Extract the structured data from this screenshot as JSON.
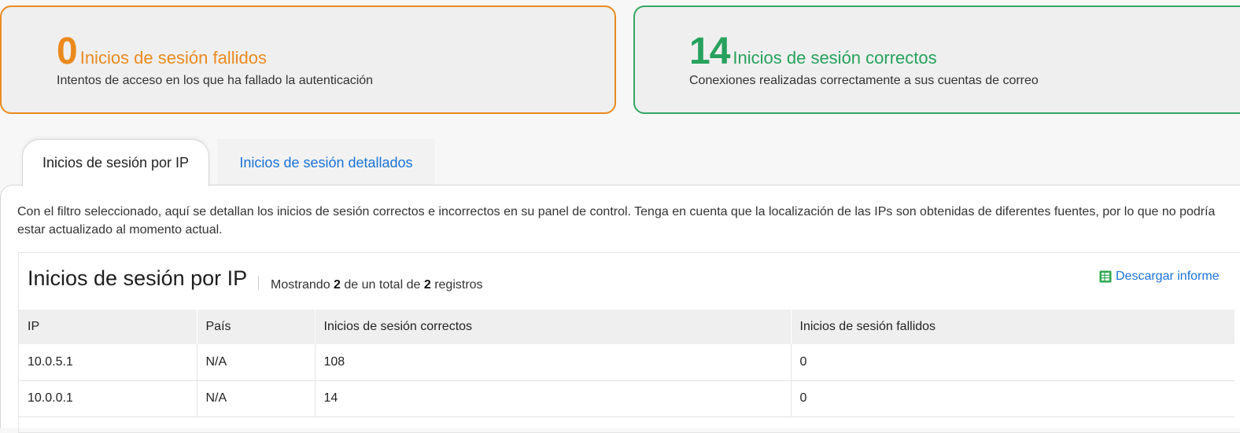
{
  "stats": {
    "failed": {
      "count": "0",
      "label": "Inicios de sesión fallidos",
      "description": "Intentos de acceso en los que ha fallado la autenticación",
      "color": "#ea8a1e"
    },
    "success": {
      "count": "14",
      "label": "Inicios de sesión correctos",
      "description": "Conexiones realizadas correctamente a sus cuentas de correo",
      "color": "#27a15d"
    }
  },
  "tabs": [
    {
      "label": "Inicios de sesión por IP",
      "active": true
    },
    {
      "label": "Inicios de sesión detallados",
      "active": false
    }
  ],
  "info_text": "Con el filtro seleccionado, aquí se detallan los inicios de sesión correctos e incorrectos en su panel de control. Tenga en cuenta que la localización de las IPs son obtenidas de diferentes fuentes, por lo que no podría estar actualizado al momento actual.",
  "report": {
    "title": "Inicios de sesión por IP",
    "count_prefix": "Mostrando",
    "count_shown": "2",
    "count_middle": "de un total de",
    "count_total": "2",
    "count_suffix": "registros",
    "download_label": "Descargar informe",
    "download_icon": "spreadsheet-icon",
    "columns": [
      "IP",
      "País",
      "Inicios de sesión correctos",
      "Inicios de sesión fallidos"
    ],
    "rows": [
      [
        "10.0.5.1",
        "N/A",
        "108",
        "0"
      ],
      [
        "10.0.0.1",
        "N/A",
        "14",
        "0"
      ]
    ]
  },
  "colors": {
    "link": "#1a73d9",
    "failed_border": "#ea8a1e",
    "success_border": "#35a565"
  }
}
